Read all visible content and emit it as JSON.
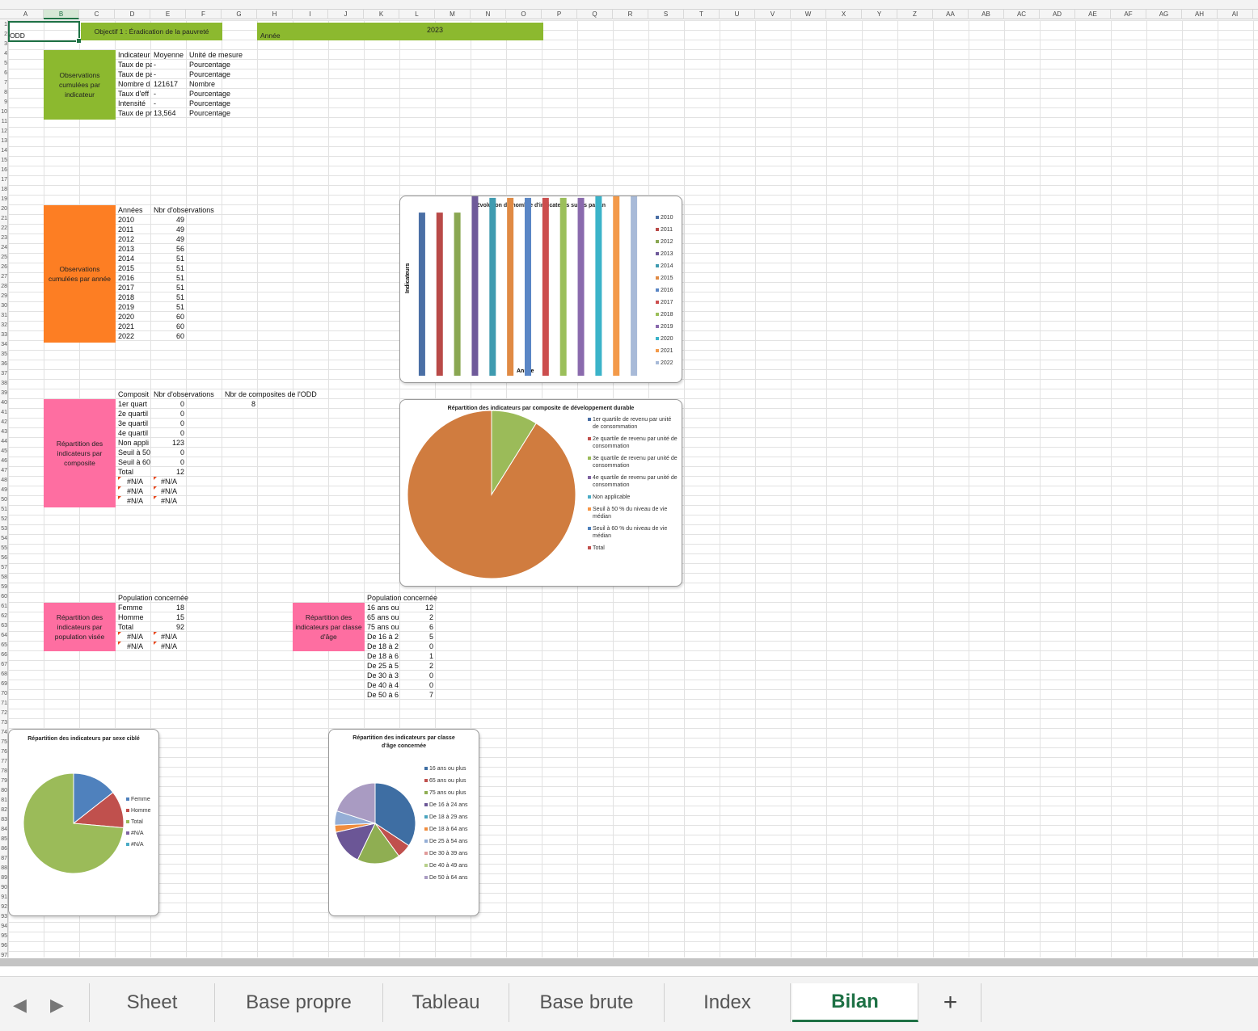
{
  "spreadsheet": {
    "column_headers": [
      "A",
      "B",
      "C",
      "D",
      "E",
      "F",
      "G",
      "H",
      "I",
      "J",
      "K",
      "L",
      "M",
      "N",
      "O",
      "P",
      "Q",
      "R",
      "S",
      "T",
      "U",
      "V",
      "W",
      "X",
      "Y",
      "Z",
      "AA",
      "AB",
      "AC",
      "AD",
      "AE",
      "AF",
      "AG",
      "AH",
      "AI"
    ],
    "active_column": "B",
    "row_headers": [
      "1",
      "2",
      "3",
      "4",
      "5",
      "6",
      "7",
      "8",
      "9",
      "10",
      "11",
      "12",
      "13",
      "14",
      "15",
      "16",
      "17",
      "18",
      "19",
      "20",
      "21",
      "22",
      "23",
      "24",
      "25",
      "26",
      "27",
      "28",
      "29",
      "30",
      "31",
      "32",
      "33",
      "34",
      "35",
      "36",
      "37",
      "38",
      "39",
      "40",
      "41",
      "42",
      "43",
      "44",
      "45",
      "46",
      "47",
      "48",
      "49",
      "50",
      "51",
      "52",
      "53",
      "54",
      "55",
      "56",
      "57",
      "58",
      "59",
      "60",
      "61",
      "62",
      "63",
      "64",
      "65",
      "66",
      "67",
      "68",
      "69",
      "70",
      "71",
      "72",
      "73",
      "74",
      "75",
      "76",
      "77",
      "78",
      "79",
      "80",
      "81",
      "82",
      "83",
      "84",
      "85",
      "86",
      "87",
      "88",
      "89",
      "90",
      "91",
      "92",
      "93",
      "94",
      "95",
      "96",
      "97"
    ]
  },
  "header": {
    "odd_label": "ODD",
    "objective": "Objectif 1 : Éradication de la pauvreté",
    "year_label": "Année",
    "year_value": "2023"
  },
  "blocks": {
    "indicator_label": "Observations cumulées par indicateur",
    "year_obs_label": "Observations cumulées par année",
    "composite_label": "Répartition des indicateurs par composite",
    "population_label": "Répartition des indicateurs par population visée",
    "age_label": "Répartition des indicateurs par classe d'âge"
  },
  "indicators_table": {
    "headers": [
      "Indicateur",
      "Moyenne",
      "Unité de mesure"
    ],
    "rows": [
      {
        "name": "Taux de pa",
        "mean": "-",
        "unit": "Pourcentage"
      },
      {
        "name": "Taux de pa",
        "mean": "-",
        "unit": "Pourcentage"
      },
      {
        "name": "Nombre d",
        "mean": "121617",
        "unit": "Nombre"
      },
      {
        "name": "Taux d'eff",
        "mean": "-",
        "unit": "Pourcentage"
      },
      {
        "name": "Intensité",
        "mean": "-",
        "unit": "Pourcentage"
      },
      {
        "name": "Taux de pr",
        "mean": "13,564",
        "unit": "Pourcentage"
      }
    ]
  },
  "years_table": {
    "headers": [
      "Années",
      "Nbr d'observations"
    ],
    "rows": [
      {
        "year": "2010",
        "count": "49"
      },
      {
        "year": "2011",
        "count": "49"
      },
      {
        "year": "2012",
        "count": "49"
      },
      {
        "year": "2013",
        "count": "56"
      },
      {
        "year": "2014",
        "count": "51"
      },
      {
        "year": "2015",
        "count": "51"
      },
      {
        "year": "2016",
        "count": "51"
      },
      {
        "year": "2017",
        "count": "51"
      },
      {
        "year": "2018",
        "count": "51"
      },
      {
        "year": "2019",
        "count": "51"
      },
      {
        "year": "2020",
        "count": "60"
      },
      {
        "year": "2021",
        "count": "60"
      },
      {
        "year": "2022",
        "count": "60"
      }
    ]
  },
  "composite_table": {
    "headers": [
      "Composit",
      "Nbr d'observations",
      "Nbr de composites de l'ODD"
    ],
    "composites_count": "8",
    "rows": [
      {
        "name": "1er quart",
        "count": "0"
      },
      {
        "name": "2e quartil",
        "count": "0"
      },
      {
        "name": "3e quartil",
        "count": "0"
      },
      {
        "name": "4e quartil",
        "count": "0"
      },
      {
        "name": "Non appli",
        "count": "123"
      },
      {
        "name": "Seuil à 50",
        "count": "0"
      },
      {
        "name": "Seuil à 60",
        "count": "0"
      },
      {
        "name": "Total",
        "count": "12"
      },
      {
        "name": "#N/A",
        "count": "#N/A"
      },
      {
        "name": "#N/A",
        "count": "#N/A"
      },
      {
        "name": "#N/A",
        "count": "#N/A"
      }
    ]
  },
  "population_table": {
    "header": "Population concernée",
    "rows": [
      {
        "name": "Femme",
        "count": "18"
      },
      {
        "name": "Homme",
        "count": "15"
      },
      {
        "name": "Total",
        "count": "92"
      },
      {
        "name": "#N/A",
        "count": "#N/A"
      },
      {
        "name": "#N/A",
        "count": "#N/A"
      }
    ]
  },
  "age_table": {
    "header": "Population concernée",
    "rows": [
      {
        "name": "16 ans ou",
        "count": "12"
      },
      {
        "name": "65 ans ou",
        "count": "2"
      },
      {
        "name": "75 ans ou",
        "count": "6"
      },
      {
        "name": "De 16 à 2",
        "count": "5"
      },
      {
        "name": "De 18 à 2",
        "count": "0"
      },
      {
        "name": "De 18 à 6",
        "count": "1"
      },
      {
        "name": "De 25 à 5",
        "count": "2"
      },
      {
        "name": "De 30 à 3",
        "count": "0"
      },
      {
        "name": "De 40 à 4",
        "count": "0"
      },
      {
        "name": "De 50 à 6",
        "count": "7"
      }
    ]
  },
  "chart_data": [
    {
      "type": "bar",
      "title": "Evolution du nombre d'indicateurs suivis par an",
      "xlabel": "Année",
      "ylabel": "Indicateurs",
      "categories": [
        "2010",
        "2011",
        "2012",
        "2013",
        "2014",
        "2015",
        "2016",
        "2017",
        "2018",
        "2019",
        "2020",
        "2021",
        "2022"
      ],
      "values": [
        49,
        49,
        49,
        56,
        51,
        51,
        51,
        51,
        51,
        51,
        60,
        60,
        60
      ],
      "colors": [
        "#4a6fa5",
        "#b94a48",
        "#8aa752",
        "#6f5a9a",
        "#3f9bb0",
        "#e08a44",
        "#5a86c5",
        "#cc4e4e",
        "#9bbf5a",
        "#8a6aad",
        "#3bb3c9",
        "#f39a4a",
        "#a8bad8"
      ],
      "legend": "right"
    },
    {
      "type": "pie",
      "title": "Répartition des indicateurs par composite de développement durable",
      "labels": [
        "1er quartile de revenu par unité de consommation",
        "2e quartile de revenu par unité de consommation",
        "3e quartile de revenu par unité de consommation",
        "4e quartile de revenu par unité de consommation",
        "Non applicable",
        "Seuil à 50 % du niveau de vie médian",
        "Seuil à 60 % du niveau de vie médian",
        "Total"
      ],
      "values": [
        0,
        0,
        0,
        0,
        123,
        0,
        0,
        12
      ],
      "colors": [
        "#4a6fa5",
        "#c0504d",
        "#9bbb59",
        "#8064a2",
        "#4bacc6",
        "#f79646",
        "#4f81bd",
        "#c0504d"
      ],
      "slice_colors": [
        "#4a6fa5",
        "#c0504d",
        "#9bbb59",
        "#8064a2",
        "#d07c3f",
        "#f79646",
        "#4f81bd",
        "#9bbb59"
      ],
      "legend": "right"
    },
    {
      "type": "pie",
      "title": "Répartition des indicateurs par sexe ciblé",
      "labels": [
        "Femme",
        "Homme",
        "Total",
        "#N/A",
        "#N/A"
      ],
      "values": [
        18,
        15,
        92,
        0,
        0
      ],
      "colors": [
        "#4f81bd",
        "#c0504d",
        "#9bbb59",
        "#8064a2",
        "#4bacc6"
      ],
      "legend": "right"
    },
    {
      "type": "pie",
      "title": "Répartition des indicateurs par classe d'âge concernée",
      "labels": [
        "16 ans ou plus",
        "65 ans ou plus",
        "75 ans ou plus",
        "De 16 à 24 ans",
        "De 18 à 29 ans",
        "De 18 à 64 ans",
        "De 25 à 54 ans",
        "De 30 à 39 ans",
        "De 40 à 49 ans",
        "De 50 à 64 ans"
      ],
      "values": [
        12,
        2,
        6,
        5,
        0,
        1,
        2,
        0,
        0,
        7
      ],
      "colors": [
        "#3e6ea3",
        "#c0504d",
        "#8fae52",
        "#6b5696",
        "#4aa4bf",
        "#f08d3e",
        "#95aed6",
        "#e19b9a",
        "#b7d08a",
        "#a99bc2"
      ],
      "legend": "right"
    }
  ],
  "sheet_tabs": {
    "tabs": [
      "Sheet",
      "Base propre",
      "Tableau",
      "Base brute",
      "Index",
      "Bilan"
    ],
    "active": "Bilan",
    "add_label": "+",
    "prev_icon": "◀",
    "next_icon": "▶"
  }
}
